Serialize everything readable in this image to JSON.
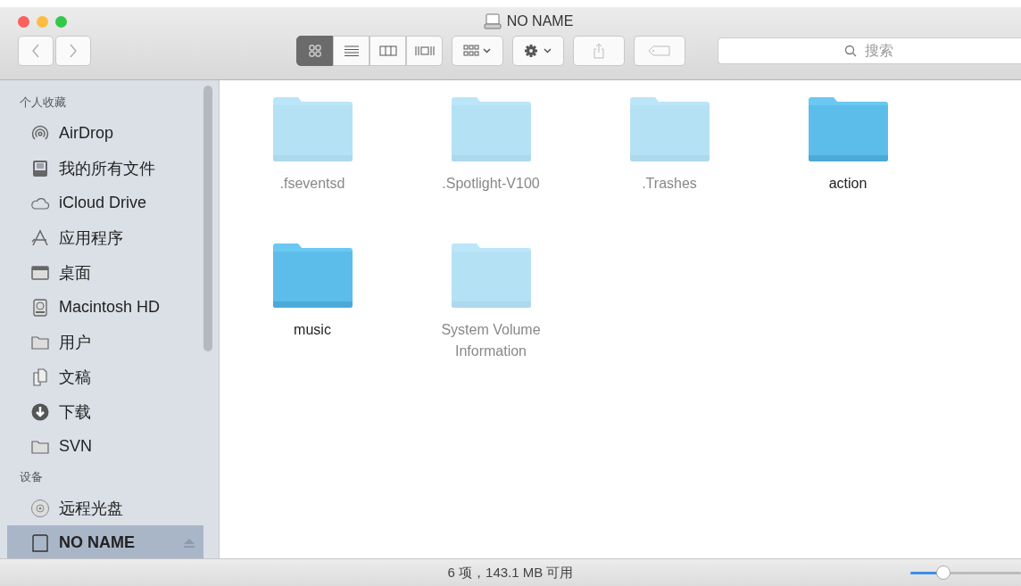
{
  "window": {
    "title": "NO NAME"
  },
  "toolbar": {
    "views": [
      {
        "kind": "icons",
        "selected": true
      },
      {
        "kind": "list",
        "selected": false
      },
      {
        "kind": "columns",
        "selected": false
      },
      {
        "kind": "coverflow",
        "selected": false
      }
    ],
    "search": {
      "placeholder": "搜索"
    }
  },
  "sidebar": {
    "sections": [
      {
        "title": "个人收藏",
        "items": [
          {
            "label": "AirDrop",
            "kind": "airdrop",
            "selected": false
          },
          {
            "label": "我的所有文件",
            "kind": "allfiles",
            "selected": false
          },
          {
            "label": "iCloud Drive",
            "kind": "cloud",
            "selected": false
          },
          {
            "label": "应用程序",
            "kind": "apps",
            "selected": false
          },
          {
            "label": "桌面",
            "kind": "desktop",
            "selected": false
          },
          {
            "label": "Macintosh HD",
            "kind": "disk",
            "selected": false
          },
          {
            "label": "用户",
            "kind": "folder",
            "selected": false
          },
          {
            "label": "文稿",
            "kind": "docs",
            "selected": false
          },
          {
            "label": "下载",
            "kind": "download",
            "selected": false
          },
          {
            "label": "SVN",
            "kind": "folder",
            "selected": false
          }
        ]
      },
      {
        "title": "设备",
        "items": [
          {
            "label": "远程光盘",
            "kind": "disc",
            "selected": false
          },
          {
            "label": "NO NAME",
            "kind": "drive",
            "selected": true
          }
        ]
      }
    ]
  },
  "files": [
    {
      "name": ".fseventsd",
      "hidden": true
    },
    {
      "name": ".Spotlight-V100",
      "hidden": true
    },
    {
      "name": ".Trashes",
      "hidden": true
    },
    {
      "name": "action",
      "hidden": false
    },
    {
      "name": "music",
      "hidden": false
    },
    {
      "name": "System Volume Information",
      "hidden": true
    }
  ],
  "status_bar": {
    "text": "6 项，143.1 MB 可用",
    "zoom": {
      "level": 0.3
    }
  }
}
